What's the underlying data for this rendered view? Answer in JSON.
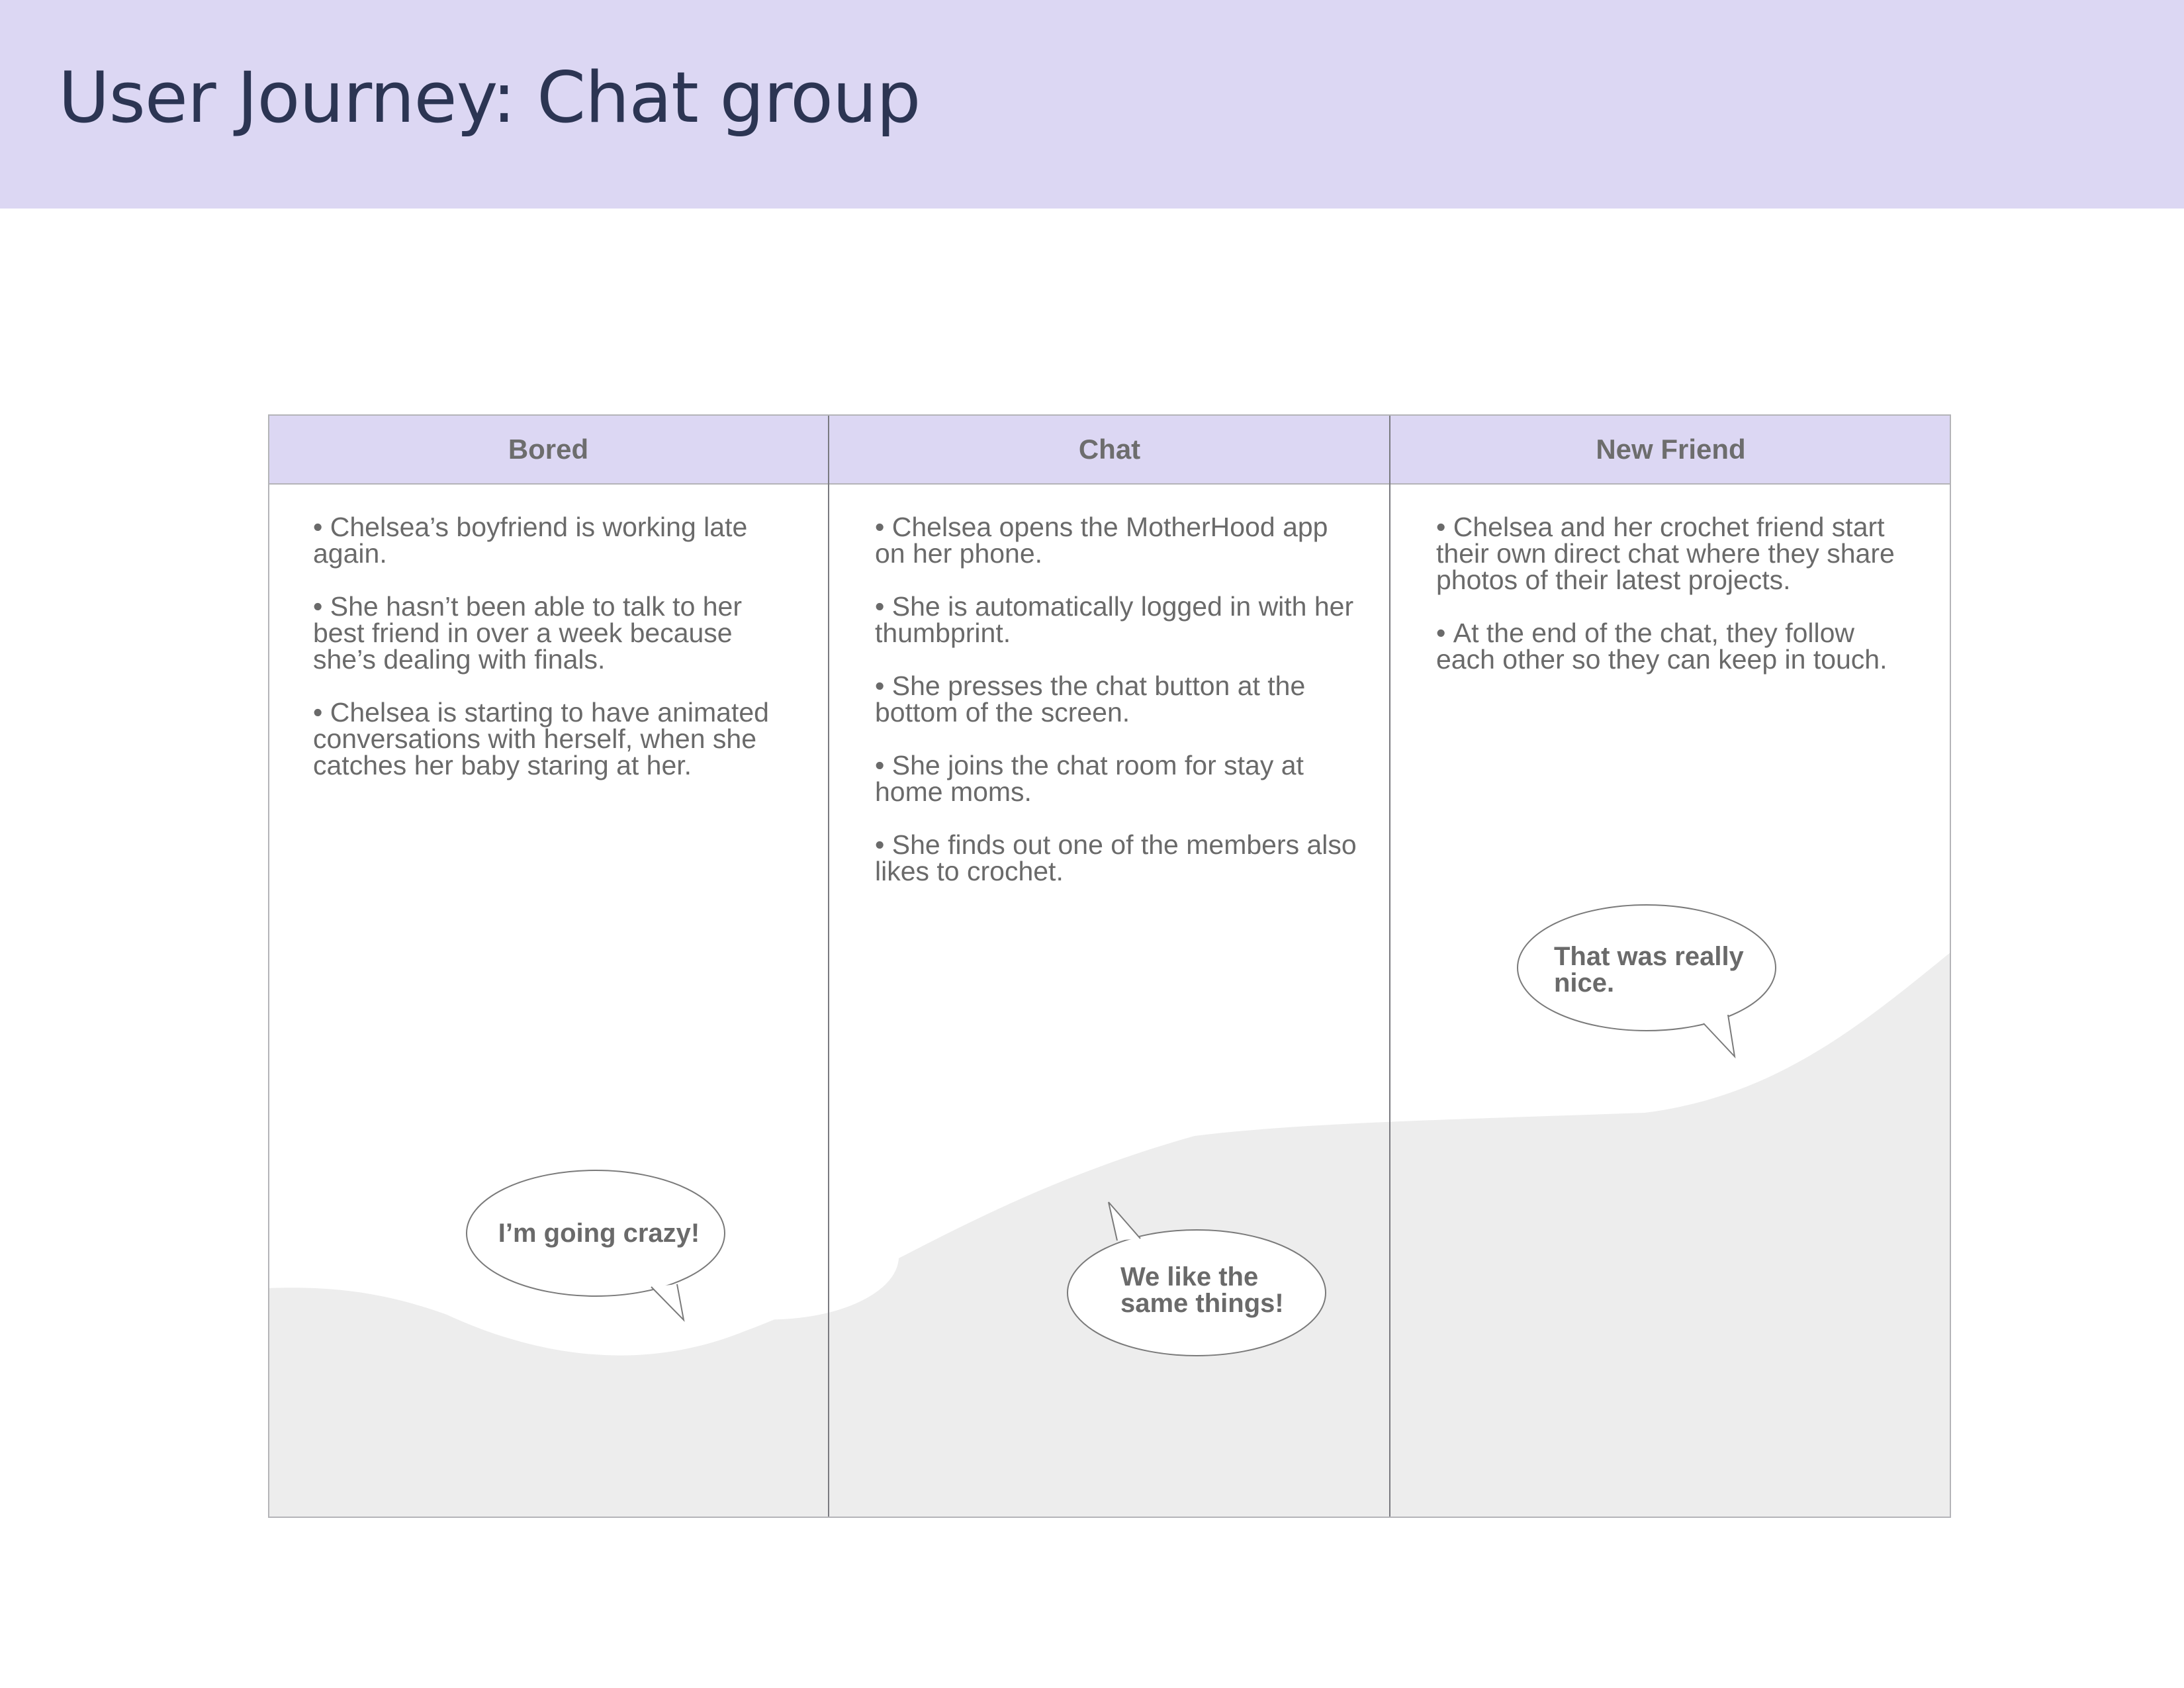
{
  "page": {
    "title": "User Journey: Chat group"
  },
  "stages": [
    {
      "name": "Bored",
      "items": [
        "Chelsea’s boyfriend is working late again.",
        "She hasn’t been able to talk to her best friend in over a week because she’s dealing with finals.",
        "Chelsea is starting to have animated conversations with herself, when she catches her baby staring at her."
      ],
      "quote": "I’m going crazy!"
    },
    {
      "name": "Chat",
      "items": [
        "Chelsea opens the MotherHood app on her phone.",
        "She is automatically logged in with her thumbprint.",
        "She presses the chat button at the bottom of the screen.",
        "She joins the chat room for stay at home moms.",
        "She finds out one of the members also likes to crochet."
      ],
      "quote": "We like the same things!"
    },
    {
      "name": "New Friend",
      "items": [
        "Chelsea and her crochet friend start their own direct chat where they share photos of their latest projects.",
        "At the end of the chat, they follow each other so they can keep in touch."
      ],
      "quote": "That was really nice."
    }
  ],
  "colors": {
    "header_band": "#dcd7f3",
    "title_text": "#2c3553",
    "body_text": "#6a6a6a",
    "emotion_area": "#ededed"
  }
}
